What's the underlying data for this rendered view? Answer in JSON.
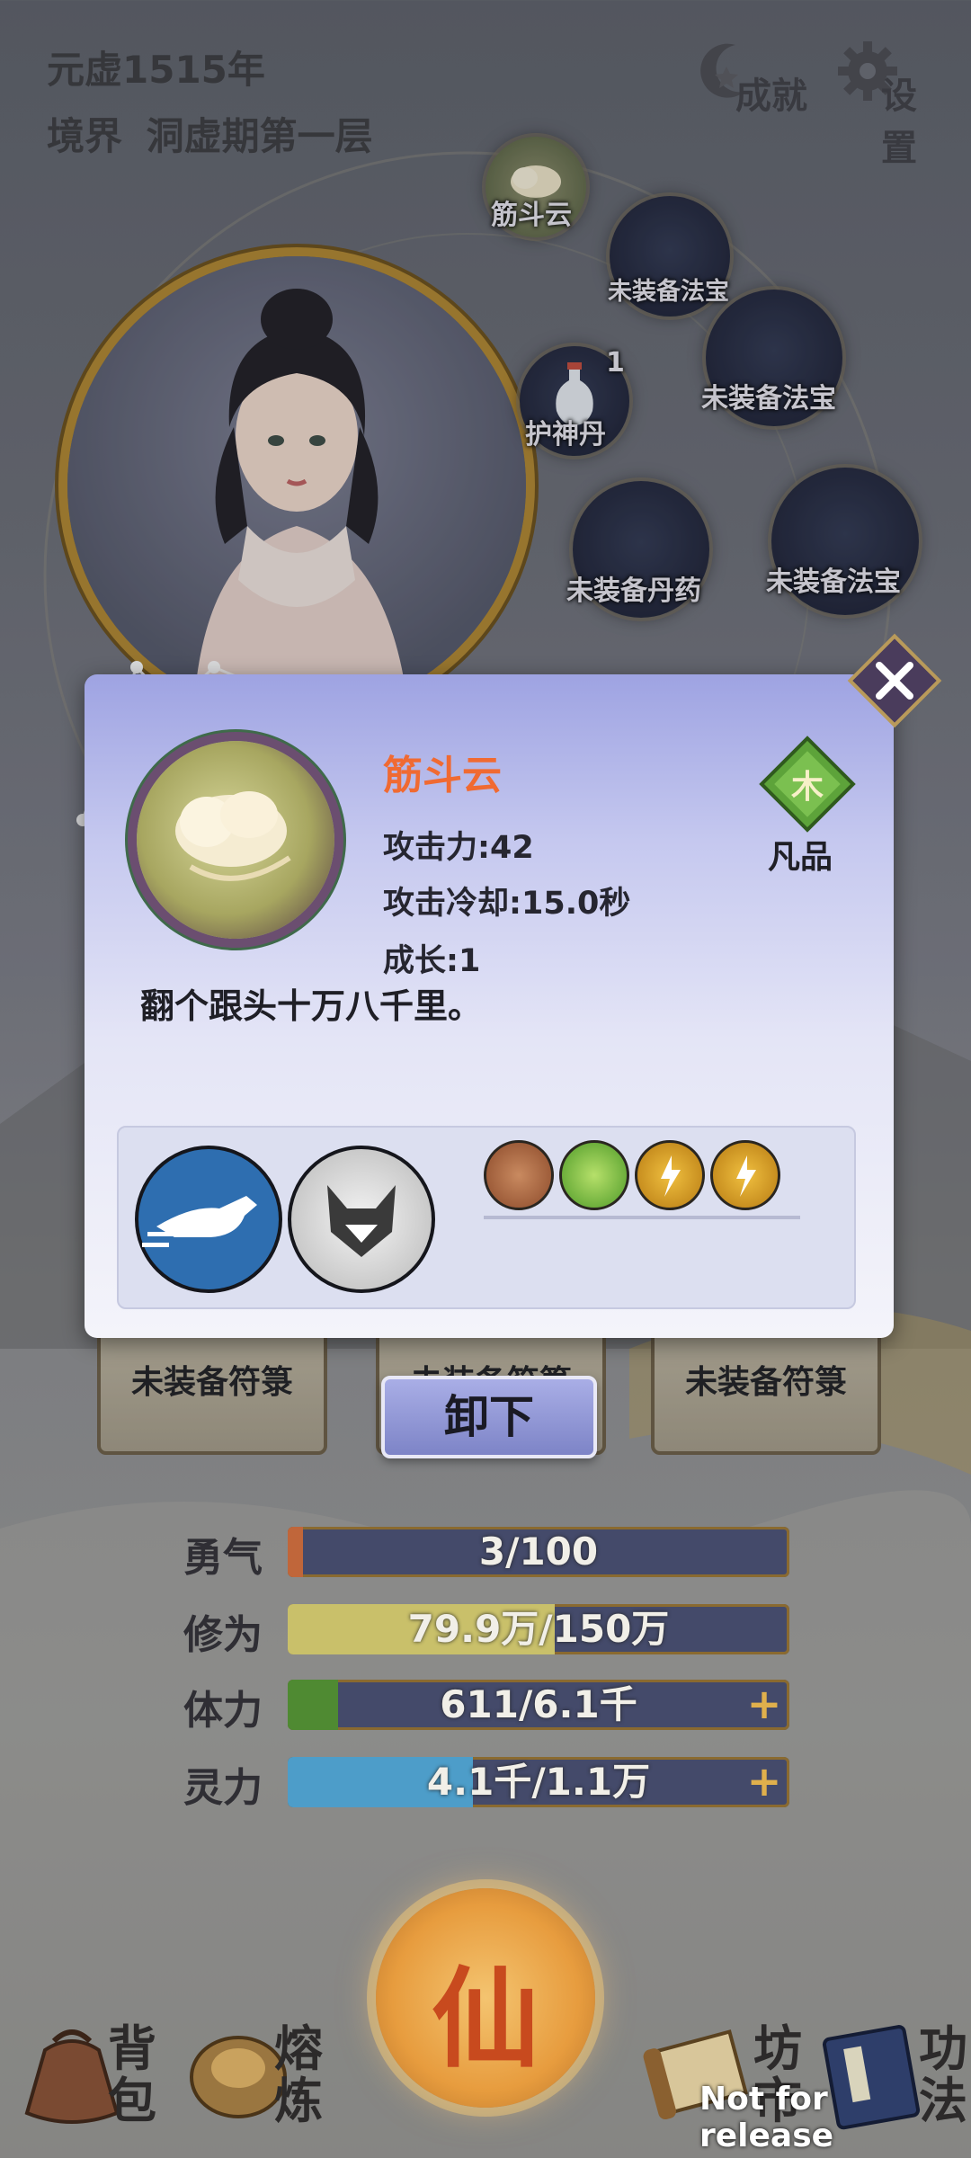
{
  "header": {
    "year": "元虚1515年",
    "realm_label": "境界",
    "realm_value": "洞虚期第一层",
    "achievements": "成就",
    "settings": "设置"
  },
  "slots": [
    {
      "label": "筋斗云"
    },
    {
      "label": "未装备法宝"
    },
    {
      "label": "未装备法宝"
    },
    {
      "label": "护神丹",
      "count": "1"
    },
    {
      "label": "未装备丹药"
    },
    {
      "label": "未装备法宝"
    }
  ],
  "dialog": {
    "name": "筋斗云",
    "attack": "攻击力:42",
    "cooldown": "攻击冷却:15.0秒",
    "growth": "成长:1",
    "description": "翻个跟头十万八千里。",
    "grade": "凡品",
    "element": "木",
    "name_color": "#f06a32"
  },
  "talismans": [
    "未装备符箓",
    "未装备符箓",
    "未装备符箓"
  ],
  "unequip_button": "卸下",
  "bars": [
    {
      "label": "勇气",
      "value": "3/100",
      "fraction": 0.03,
      "color": "#c0663a",
      "plus": false
    },
    {
      "label": "修为",
      "value": "79.9万/150万",
      "fraction": 0.533,
      "color": "#c9c06a",
      "plus": false
    },
    {
      "label": "体力",
      "value": "611/6.1千",
      "fraction": 0.1,
      "color": "#4f8a32",
      "plus": true
    },
    {
      "label": "灵力",
      "value": "4.1千/1.1万",
      "fraction": 0.37,
      "color": "#4d9dc9",
      "plus": true
    }
  ],
  "nav": {
    "bag": "背包",
    "smelt": "熔炼",
    "center": "仙",
    "market": "坊市",
    "skills": "功法"
  },
  "watermark": "Not for release"
}
